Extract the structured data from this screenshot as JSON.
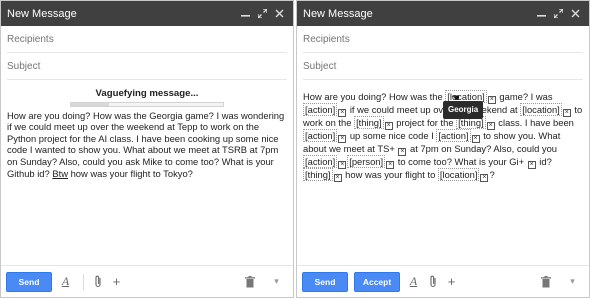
{
  "left": {
    "title": "New Message",
    "recipients_placeholder": "Recipients",
    "subject_placeholder": "Subject",
    "banner": "Vaguefying message...",
    "progress": 0.25,
    "body_part1": "How are you doing? How was the Georgia game? I was wondering if we could meet up over the weekend at Tepp  to work on the Python project for the AI class. I have been cooking up some nice code I wanted to show you. What about we meet at TSRB at 7pm on Sunday? Also, could you ask Mike to come too? What is your Github id? ",
    "body_underlined": "Btw",
    "body_part2": " how was your flight to Tokyo?",
    "send_label": "Send"
  },
  "right": {
    "title": "New Message",
    "recipients_placeholder": "Recipients",
    "subject_placeholder": "Subject",
    "tooltip": "Georgia",
    "seg": [
      "How are you doing? How was the ",
      "[location]",
      " game? I was ",
      "[action]",
      " if we could meet up over the weekend at ",
      "[location]",
      " to work on the ",
      "[thing]",
      " project for the ",
      "[thing]",
      " class. I have been ",
      "[action]",
      " up some nice code I ",
      "[action]",
      " to show you. What about we meet at TS+ ",
      " at 7pm on Sunday? Also, could you ",
      "[action]",
      "[person]",
      " to come too? What is your Gi+ ",
      " id? ",
      "[thing]",
      " how was your flight to ",
      "[location]",
      "?"
    ],
    "send_label": "Send",
    "accept_label": "Accept"
  },
  "icons": {
    "minimize": "minimize-icon",
    "expand": "expand-icon",
    "close": "close-icon",
    "format": "format-text-icon",
    "attach": "paperclip-icon",
    "insert": "plus-icon",
    "delete": "trash-icon",
    "more": "more-options-icon",
    "remove_tag": "remove-tag-icon"
  },
  "colors": {
    "titlebar": "#404040",
    "send_button": "#4a8af4"
  }
}
